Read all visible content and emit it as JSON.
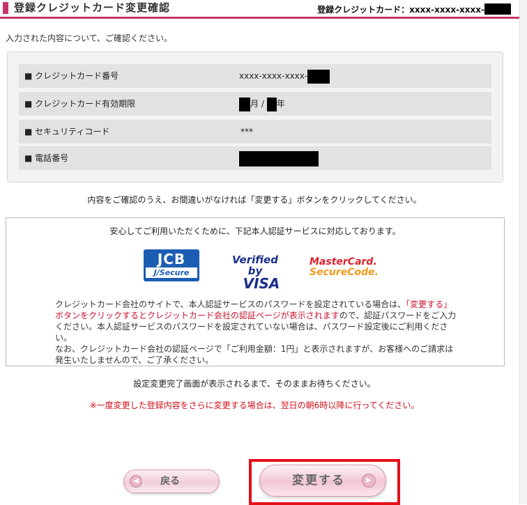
{
  "header": {
    "title": "登録クレジットカード変更確認",
    "card_label": "登録クレジットカード：",
    "card_number_masked": "xxxx-xxxx-xxxx-"
  },
  "intro": "入力された内容について、ご確認ください。",
  "fields": [
    {
      "label": "クレジットカード番号",
      "value": "xxxx-xxxx-xxxx-"
    },
    {
      "label": "クレジットカード有効期限",
      "month_suffix": "月 /",
      "year_suffix": "年"
    },
    {
      "label": "セキュリティコード",
      "value": "***"
    },
    {
      "label": "電話番号",
      "value": ""
    }
  ],
  "confirm_message": "内容をご確認のうえ、お間違いがなければ「変更する」ボタンをクリックしてください。",
  "auth": {
    "lead": "安心してご利用いただくために、下記本人認証サービスに対応しております。",
    "logos": {
      "jcb_line1": "JCB",
      "jcb_line2": "J/Secure",
      "visa_line1": "Verified by",
      "visa_line2": "VISA",
      "mc_line1": "MasterCard.",
      "mc_line2": "SecureCode."
    },
    "desc_1": "クレジットカード会社のサイトで、本人認証サービスのパスワードを設定されている場合は、",
    "desc_red": "「変更する」ボタンをクリックするとクレジットカード会社の認証ページが表示されます",
    "desc_2": "ので、認証パスワードをご入力ください。本人認証サービスのパスワードを設定されていない場合は、パスワード設定後にご利用ください。",
    "desc_3": "なお、クレジットカード会社の認証ページで「ご利用金額：1円」と表示されますが、お客様へのご請求は発生いたしませんので、ご了承ください。"
  },
  "wait_message": "設定変更完了画面が表示されるまで、そのままお待ちください。",
  "warning": "※一度変更した登録内容をさらに変更する場合は、翌日の朝6時以降に行ってください。",
  "buttons": {
    "back": "戻る",
    "submit": "変更する"
  },
  "colors": {
    "accent": "#c8336a",
    "warning": "#d0101a",
    "highlight_frame": "#e4101a"
  }
}
